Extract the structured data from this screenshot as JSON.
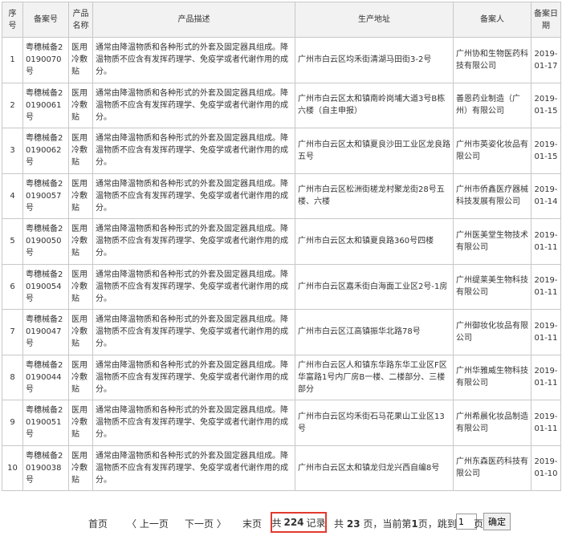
{
  "table": {
    "headers": {
      "index": "序号",
      "record_no": "备案号",
      "product_name": "产品名称",
      "description": "产品描述",
      "address": "生产地址",
      "filer": "备案人",
      "date": "备案日期"
    },
    "rows": [
      {
        "index": "1",
        "record_no": "粤穗械备20190070号",
        "product_name": "医用冷敷贴",
        "description": "通常由降温物质和各种形式的外套及固定器具组成。降温物质不应含有发挥药理学、免疫学或者代谢作用的成分。",
        "address": "广州市白云区均禾街清湖马田街3-2号",
        "filer": "广州协和生物医药科技有限公司",
        "date": "2019-01-17"
      },
      {
        "index": "2",
        "record_no": "粤穗械备20190061号",
        "product_name": "医用冷敷贴",
        "description": "通常由降温物质和各种形式的外套及固定器具组成。降温物质不应含有发挥药理学、免疫学或者代谢作用的成分。",
        "address": "广州市白云区太和镇南岭岗埔大道3号B栋六楼（自主申报）",
        "filer": "善恩药业制造（广州）有限公司",
        "date": "2019-01-15"
      },
      {
        "index": "3",
        "record_no": "粤穗械备20190062号",
        "product_name": "医用冷敷贴",
        "description": "通常由降温物质和各种形式的外套及固定器具组成。降温物质不应含有发挥药理学、免疫学或者代谢作用的成分。",
        "address": "广州市白云区太和镇夏良沙田工业区龙良路五号",
        "filer": "广州市英姿化妆品有限公司",
        "date": "2019-01-15"
      },
      {
        "index": "4",
        "record_no": "粤穗械备20190057号",
        "product_name": "医用冷敷贴",
        "description": "通常由降温物质和各种形式的外套及固定器具组成。降温物质不应含有发挥药理学、免疫学或者代谢作用的成分。",
        "address": "广州市白云区松洲街槎龙村聚龙街28号五楼、六楼",
        "filer": "广州市侨鑫医疗器械科技发展有限公司",
        "date": "2019-01-14"
      },
      {
        "index": "5",
        "record_no": "粤穗械备20190050号",
        "product_name": "医用冷敷贴",
        "description": "通常由降温物质和各种形式的外套及固定器具组成。降温物质不应含有发挥药理学、免疫学或者代谢作用的成分。",
        "address": "广州市白云区太和镇夏良路360号四楼",
        "filer": "广州医美堂生物技术有限公司",
        "date": "2019-01-11"
      },
      {
        "index": "6",
        "record_no": "粤穗械备20190054号",
        "product_name": "医用冷敷贴",
        "description": "通常由降温物质和各种形式的外套及固定器具组成。降温物质不应含有发挥药理学、免疫学或者代谢作用的成分。",
        "address": "广州市白云区嘉禾街白海面工业区2号-1房",
        "filer": "广州缇莱美生物科技有限公司",
        "date": "2019-01-11"
      },
      {
        "index": "7",
        "record_no": "粤穗械备20190047号",
        "product_name": "医用冷敷贴",
        "description": "通常由降温物质和各种形式的外套及固定器具组成。降温物质不应含有发挥药理学、免疫学或者代谢作用的成分。",
        "address": "广州市白云区江高镇振华北路78号",
        "filer": "广州御妆化妆品有限公司",
        "date": "2019-01-11"
      },
      {
        "index": "8",
        "record_no": "粤穗械备20190044号",
        "product_name": "医用冷敷贴",
        "description": "通常由降温物质和各种形式的外套及固定器具组成。降温物质不应含有发挥药理学、免疫学或者代谢作用的成分。",
        "address": "广州市白云区人和镇东华路东华工业区F区华富路1号内厂房B一楼、二楼部分、三楼部分",
        "filer": "广州华雅威生物科技有限公司",
        "date": "2019-01-11"
      },
      {
        "index": "9",
        "record_no": "粤穗械备20190051号",
        "product_name": "医用冷敷贴",
        "description": "通常由降温物质和各种形式的外套及固定器具组成。降温物质不应含有发挥药理学、免疫学或者代谢作用的成分。",
        "address": "广州市白云区均禾街石马花果山工业区13号",
        "filer": "广州希晨化妆品制造有限公司",
        "date": "2019-01-11"
      },
      {
        "index": "10",
        "record_no": "粤穗械备20190038号",
        "product_name": "医用冷敷贴",
        "description": "通常由降温物质和各种形式的外套及固定器具组成。降温物质不应含有发挥药理学、免疫学或者代谢作用的成分。",
        "address": "广州市白云区太和镇龙归龙兴西自编8号",
        "filer": "广州东森医药科技有限公司",
        "date": "2019-01-10"
      }
    ]
  },
  "pagination": {
    "first": "首页",
    "prev": "〈 上一页",
    "next": "下一页 〉",
    "last": "末页",
    "total_prefix": "共",
    "total_count": "224",
    "total_suffix": "记录",
    "pages_prefix": "共",
    "pages_count": "23",
    "pages_mid": "页，当前第",
    "current_page": "1",
    "pages_suffix": "页，跳到",
    "jump_value": "1",
    "jump_unit": "页",
    "confirm": "确定"
  },
  "colors": {
    "highlight_border": "#e23a2e",
    "header_bg": "#f2f2f2",
    "grid_line": "#c8c8c8"
  }
}
